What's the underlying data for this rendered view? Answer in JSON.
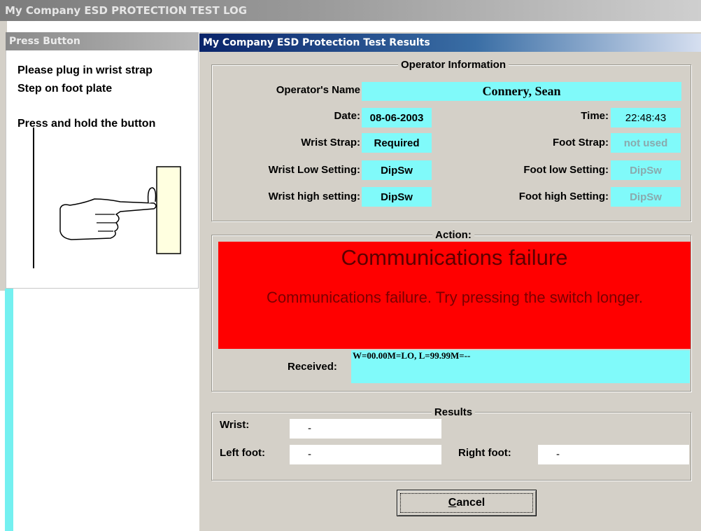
{
  "window": {
    "title": "My Company ESD PROTECTION TEST LOG"
  },
  "press_panel": {
    "title": "Press Button",
    "line1": "Please plug in wrist strap",
    "line2": "Step on foot plate",
    "line3": "Press and hold the button",
    "illustration": "hand-pressing-button-icon"
  },
  "dialog": {
    "title": "My Company ESD Protection Test Results",
    "operator": {
      "legend": "Operator Information",
      "name_label": "Operator's Name",
      "name_value": "Connery, Sean",
      "date_label": "Date:",
      "date_value": "08-06-2003",
      "time_label": "Time:",
      "time_value": "22:48:43",
      "wrist_strap_label": "Wrist Strap:",
      "wrist_strap_value": "Required",
      "foot_strap_label": "Foot Strap:",
      "foot_strap_value": "not used",
      "wrist_low_label": "Wrist Low Setting:",
      "wrist_low_value": "DipSw",
      "foot_low_label": "Foot low Setting:",
      "foot_low_value": "DipSw",
      "wrist_high_label": "Wrist high setting:",
      "wrist_high_value": "DipSw",
      "foot_high_label": "Foot high Setting:",
      "foot_high_value": "DipSw"
    },
    "action": {
      "legend": "Action:",
      "headline": "Communications failure",
      "message": "Communications failure.  Try pressing the switch longer.",
      "received_label": "Received:",
      "received_value": "W=00.00M=LO, L=99.99M=--"
    },
    "results": {
      "legend": "Results",
      "wrist_label": "Wrist:",
      "wrist_value": "-",
      "left_foot_label": "Left foot:",
      "left_foot_value": "-",
      "right_foot_label": "Right foot:",
      "right_foot_value": "-"
    },
    "cancel_label": "Cancel"
  },
  "colors": {
    "field_cyan": "#80fafa",
    "alert_red": "#ff0000",
    "dialog_gray": "#d4d0c8",
    "titlebar_blue": "#0a246a"
  }
}
